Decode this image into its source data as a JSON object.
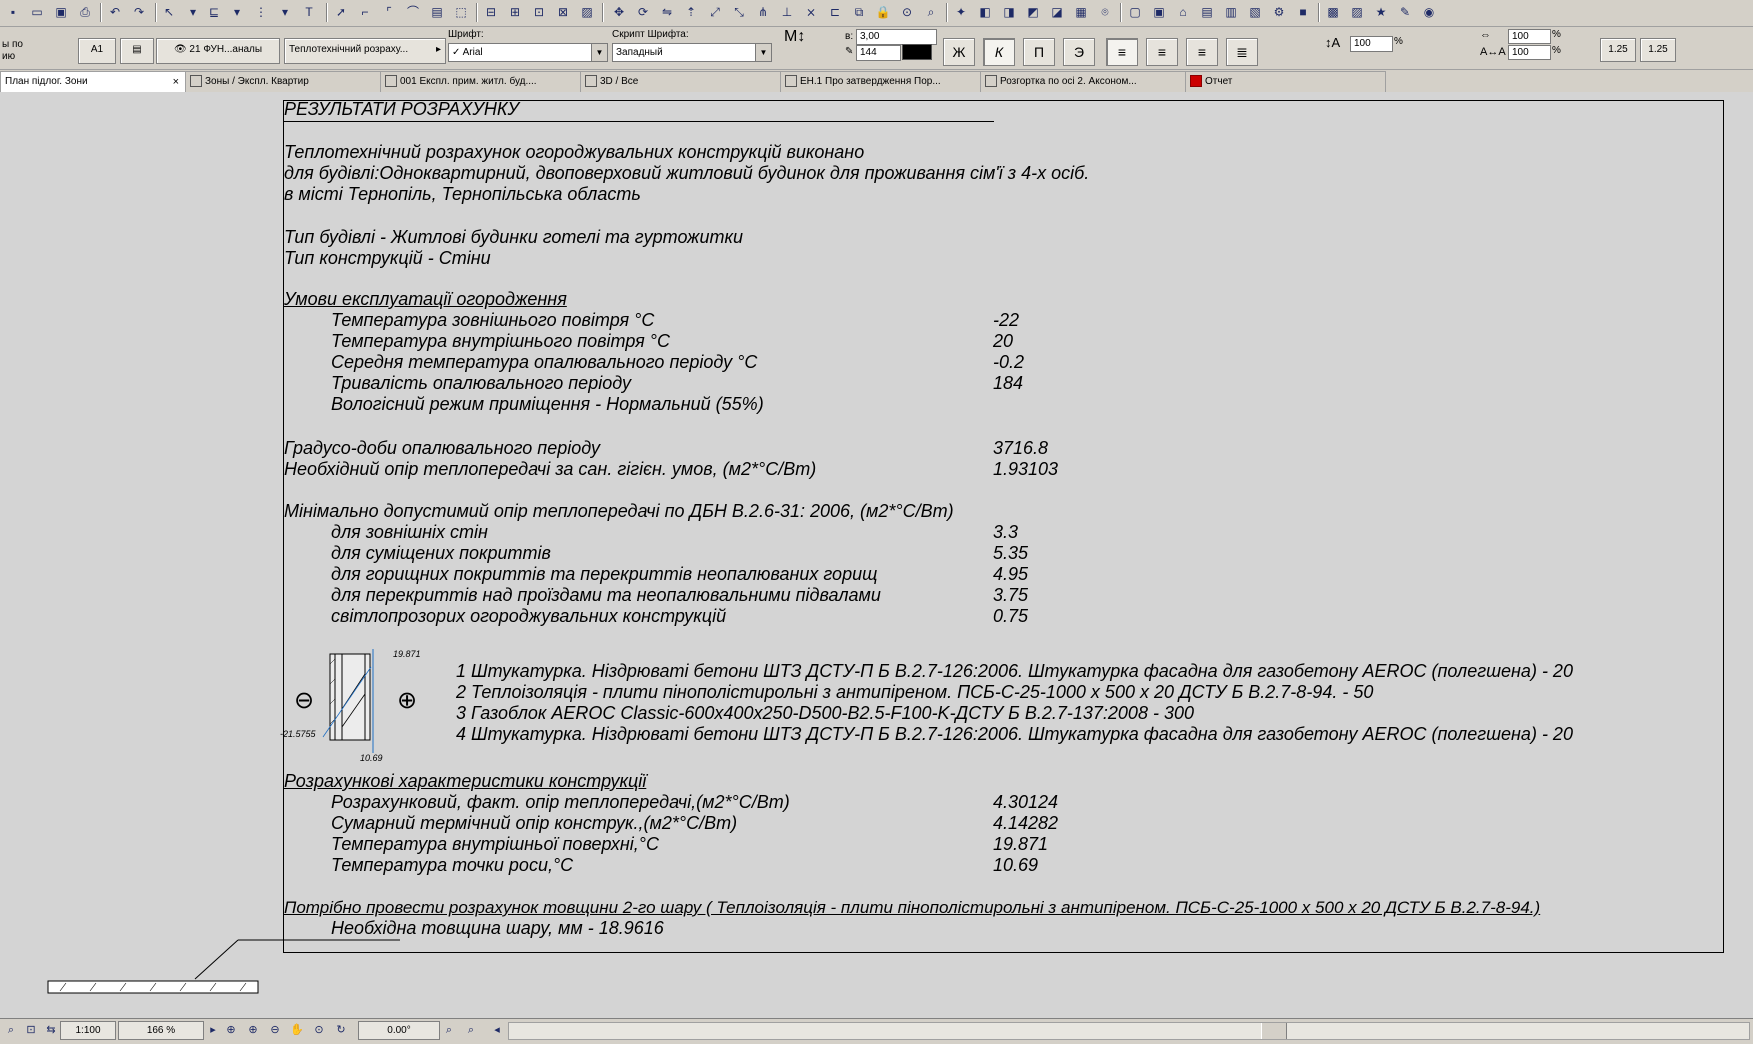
{
  "toolbar2": {
    "left_label_1": "ы по",
    "left_label_2": "ию",
    "label_button": "A1",
    "view_button": "21 ФУН...аналы",
    "view_dropdown": "Теплотехнічний розраху...",
    "font_caption": "Шрифт:",
    "font_value": "✓ Arial",
    "script_caption": "Скрипт Шрифта:",
    "script_value": "Западный",
    "size_value": "3,00",
    "pen_value": "144",
    "bold_label": "Ж",
    "italic_label": "К",
    "underline_label": "П",
    "strike_label": "Э",
    "spacing_value": "100",
    "width_value": "100",
    "height_value": "100",
    "pct1": "%",
    "pct2": "%",
    "pct3": "%",
    "scale1": "1.25",
    "scale2": "1.25"
  },
  "tabs": [
    {
      "label": "План підлог. Зони",
      "close": "×"
    },
    {
      "label": "Зоны / Экспл. Квартир"
    },
    {
      "label": "001 Експл. прим. житл. буд...."
    },
    {
      "label": "3D / Все"
    },
    {
      "label": "ЕН.1 Про затвердження Пор..."
    },
    {
      "label": "Розгортка по осі 2. Аксоном..."
    },
    {
      "label": "Отчет"
    }
  ],
  "doc": {
    "title": "РЕЗУЛЬТАТИ РОЗРАХУНКУ",
    "intro_1": "Теплотехнічний розрахунок огороджувальних конструкцій виконано",
    "intro_2": "для будівлі:Одноквартирний, двоповерховий житловий будинок для проживання сім'ї з 4-х осіб.",
    "intro_3": "в місті    Тернопіль, Тернопільська область",
    "building_type": "Тип будівлі - Житлові будинки готелі та гуртожитки",
    "construction_type": "Тип конструкцій - Стіни",
    "conditions_heading": "Умови експлуатації огородження",
    "conditions": [
      {
        "label": "Температура зовнішнього повітря °С",
        "value": "-22"
      },
      {
        "label": "Температура внутрішнього повітря °С",
        "value": "20"
      },
      {
        "label": "Середня температура опалювального періоду °С",
        "value": "-0.2"
      },
      {
        "label": "Тривалість опалювального періоду",
        "value": "184"
      }
    ],
    "humidity": "Вологісний режим приміщення - Нормальний (55%)",
    "degree_days_label": "Градусо-доби опалювального періоду",
    "degree_days_value": "3716.8",
    "required_res_label": "Необхідний опір теплопередачі за сан. гігієн. умов, (м2*°С/Вт)",
    "required_res_value": "1.93103",
    "min_heading": "Мінімально допустимий опір теплопередачі по ДБН В.2.6-31: 2006, (м2*°С/Вт)",
    "min_values": [
      {
        "label": "для зовнішніх стін",
        "value": "3.3"
      },
      {
        "label": "для суміщених покриттів",
        "value": "5.35"
      },
      {
        "label": "для горищних покриттів та перекриттів неопалюваних горищ",
        "value": "4.95"
      },
      {
        "label": "для перекриттів над проїздами та неопалювальними підвалами",
        "value": "3.75"
      },
      {
        "label": "світлопрозорих огороджувальних конструкцій",
        "value": "0.75"
      }
    ],
    "diagram": {
      "top_value": "19.871",
      "left_value": "-21.5755",
      "bottom_value": "10.69",
      "minus": "⊖",
      "plus": "⊕"
    },
    "layers": [
      "1    Штукатурка. Ніздрюваті бетони ШТЗ  ДСТУ-П Б В.2.7-126:2006. Штукатурка фасадна для газобетону AEROC (полегшена)  -  20",
      "2    Теплоізоляція - плити  пінополістирольні з антипіреном. ПСБ-С-25-1000 х 500 х 20 ДСТУ Б В.2.7-8-94. -  50",
      "3     Газоблок AEROC Classic-600x400x250-D500-B2.5-F100-K-ДСТУ Б В.2.7-137:2008 -  300",
      "4    Штукатурка. Ніздрюваті бетони ШТЗ  ДСТУ-П Б В.2.7-126:2006. Штукатурка фасадна для газобетону AEROC (полегшена)  -  20"
    ],
    "calc_heading": "Розрахункові характеристики конструкції",
    "calc_values": [
      {
        "label": "Розрахунковий, факт. опір теплопередачі,(м2*°С/Вт)",
        "value": "4.30124"
      },
      {
        "label": "Сумарний термічний опір конструк.,(м2*°С/Вт)",
        "value": "4.14282"
      },
      {
        "label": "Температура внутрішньої поверхні,°С",
        "value": "19.871"
      },
      {
        "label": "Температура точки роси,°С",
        "value": "10.69"
      }
    ],
    "note": "Потрібно провести розрахунок товщини 2-го шару (  Теплоізоляція - плити  пінополістирольні з антипіреном. ПСБ-С-25-1000 х 500 х 20 ДСТУ Б В.2.7-8-94.)",
    "note_value": "Необхідна товщина шару, мм - 18.9616"
  },
  "status": {
    "scale": "1:100",
    "zoom": "166 %",
    "angle": "0.00°"
  }
}
